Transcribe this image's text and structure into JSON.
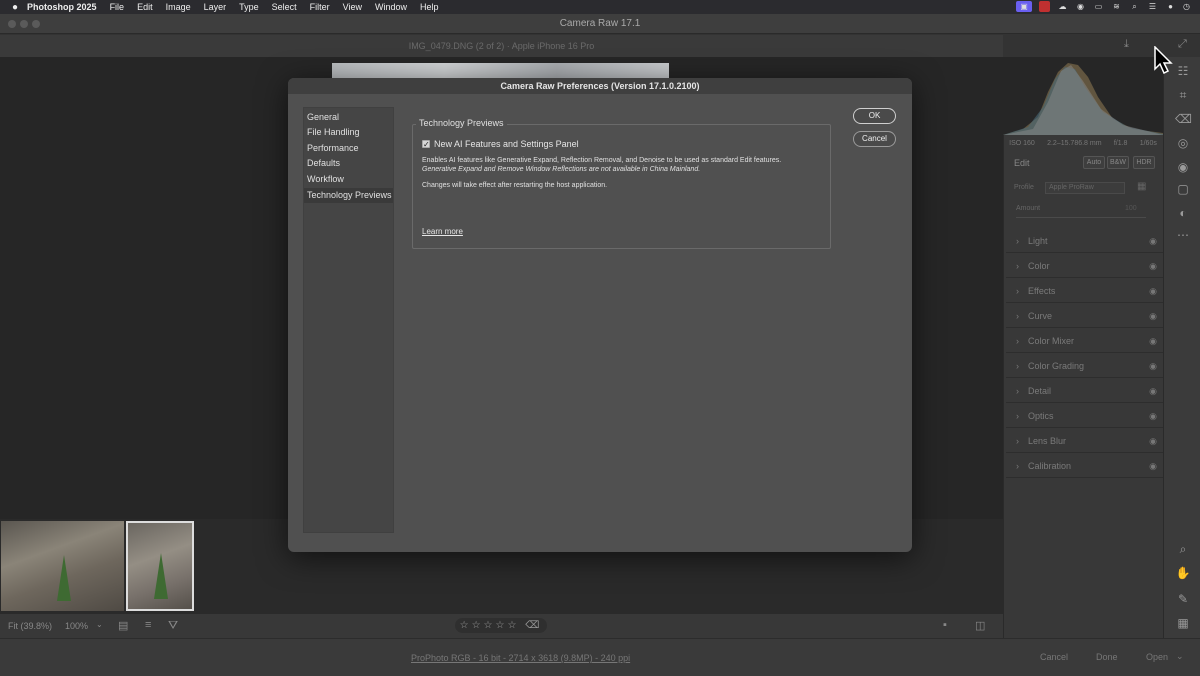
{
  "menubar": {
    "app": "Photoshop 2025",
    "items": [
      "File",
      "Edit",
      "Image",
      "Layer",
      "Type",
      "Select",
      "Filter",
      "View",
      "Window",
      "Help"
    ]
  },
  "window": {
    "title": "Camera Raw 17.1",
    "file_info": "IMG_0479.DNG (2 of 2)  ·  Apple iPhone 16 Pro"
  },
  "right_panel": {
    "camera_info": [
      "ISO 160",
      "2.2–15.786.8 mm",
      "f/1.8",
      "1/60s"
    ],
    "edit_label": "Edit",
    "auto": "Auto",
    "bw": "B&W",
    "hdr": "HDR",
    "profile_label": "Profile",
    "profile_value": "Apple ProRaw",
    "amount_label": "Amount",
    "amount_value": "100",
    "sections": [
      "Light",
      "Color",
      "Effects",
      "Curve",
      "Color Mixer",
      "Color Grading",
      "Detail",
      "Optics",
      "Lens Blur",
      "Calibration"
    ]
  },
  "bottom": {
    "zoom_fit": "Fit (39.8%)",
    "zoom_pct": "100%",
    "workflow": "ProPhoto RGB - 16 bit - 2714 x 3618 (9.8MP) - 240 ppi",
    "cancel": "Cancel",
    "done": "Done",
    "open": "Open"
  },
  "dialog": {
    "title": "Camera Raw Preferences  (Version 17.1.0.2100)",
    "nav": [
      "General",
      "File Handling",
      "Performance",
      "Defaults",
      "Workflow",
      "Technology Previews"
    ],
    "selected_nav": "Technology Previews",
    "group_title": "Technology Previews",
    "checkbox_label": "New AI Features and Settings Panel",
    "checkbox_checked": true,
    "description": "Enables AI features like Generative Expand, Reflection Removal, and Denoise to be used as standard Edit features.",
    "description_italic": "Generative Expand and Remove Window Reflections are not available in China Mainland.",
    "restart_note": "Changes will take effect after restarting the host application.",
    "learn_more": "Learn more",
    "ok": "OK",
    "cancel": "Cancel"
  },
  "colors": {
    "dialog_bg": "#505050",
    "accent_menubar_icon": "#6a5ff0"
  }
}
